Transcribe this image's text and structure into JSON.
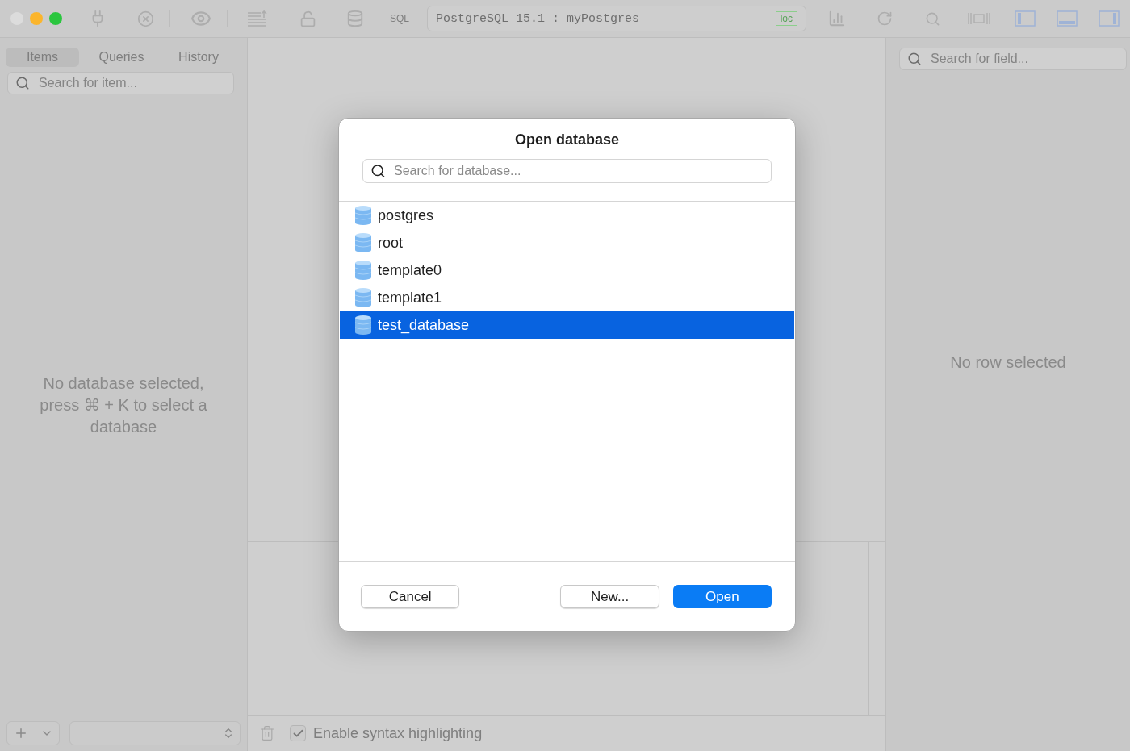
{
  "toolbar": {
    "sql_label": "SQL",
    "connection": "PostgreSQL 15.1 : myPostgres",
    "badge": "loc"
  },
  "sidebar": {
    "tabs": [
      {
        "label": "Items",
        "selected": true
      },
      {
        "label": "Queries",
        "selected": false
      },
      {
        "label": "History",
        "selected": false
      }
    ],
    "search": {
      "placeholder": "Search for item..."
    },
    "empty_message": "No database selected, press ⌘ + K to select a database"
  },
  "inspector": {
    "search": {
      "placeholder": "Search for field..."
    },
    "empty_message": "No row selected"
  },
  "bottom_bar": {
    "syntax_highlighting": {
      "label": "Enable syntax highlighting",
      "checked": true
    }
  },
  "dialog": {
    "title": "Open database",
    "search": {
      "placeholder": "Search for database..."
    },
    "databases": [
      {
        "name": "postgres",
        "selected": false
      },
      {
        "name": "root",
        "selected": false
      },
      {
        "name": "template0",
        "selected": false
      },
      {
        "name": "template1",
        "selected": false
      },
      {
        "name": "test_database",
        "selected": true
      }
    ],
    "buttons": [
      {
        "label": "Cancel",
        "kind": "secondary"
      },
      {
        "label": "New...",
        "kind": "secondary"
      },
      {
        "label": "Open",
        "kind": "primary"
      }
    ]
  }
}
